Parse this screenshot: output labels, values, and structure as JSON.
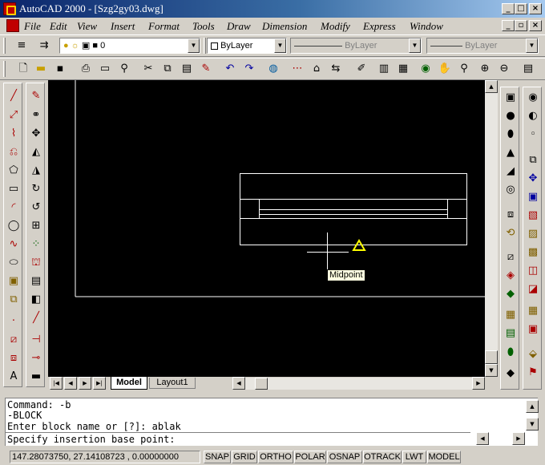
{
  "window": {
    "title": "AutoCAD 2000 - [Szg2gy03.dwg]",
    "controls": {
      "minimize": "_",
      "maximize": "□",
      "close": "×"
    }
  },
  "menu": [
    "File",
    "Edit",
    "View",
    "Insert",
    "Format",
    "Tools",
    "Draw",
    "Dimension",
    "Modify",
    "Express",
    "Window"
  ],
  "layer_toolbar": {
    "layer_value": "0",
    "color_value": "ByLayer",
    "linetype_value": "ByLayer",
    "lineweight_value": "ByLayer"
  },
  "canvas": {
    "background": "#000000",
    "snap_tooltip": "Midpoint",
    "snap_marker_color": "#ffff00"
  },
  "tabs": {
    "model": "Model",
    "layout1": "Layout1"
  },
  "command": {
    "lines": [
      "Command: -b",
      "-BLOCK",
      "Enter block name or [?]: ablak"
    ],
    "prompt": "Specify insertion base point:"
  },
  "status": {
    "coords": "147.28073750, 27.14108723 , 0.00000000",
    "buttons": [
      "SNAP",
      "GRID",
      "ORTHO",
      "POLAR",
      "OSNAP",
      "OTRACK",
      "LWT",
      "MODEL"
    ]
  },
  "icons": {
    "left_tool_1": [
      "line-icon",
      "xline-icon",
      "polyline-icon",
      "polygon-icon",
      "rectangle-icon",
      "arc-icon",
      "circle-icon",
      "spline-icon",
      "ellipse-icon",
      "insert-block-icon",
      "make-block-icon",
      "point-icon",
      "hatch-icon",
      "region-icon",
      "mtext-icon"
    ],
    "left_tool_2": [
      "erase-icon",
      "copy-icon",
      "mirror-icon",
      "offset-icon",
      "array-icon",
      "move-icon",
      "rotate-icon",
      "scale-icon",
      "stretch-icon",
      "lengthen-icon",
      "trim-icon",
      "extend-icon",
      "break-icon",
      "chamfer-icon",
      "fillet-icon",
      "explode-icon"
    ]
  }
}
